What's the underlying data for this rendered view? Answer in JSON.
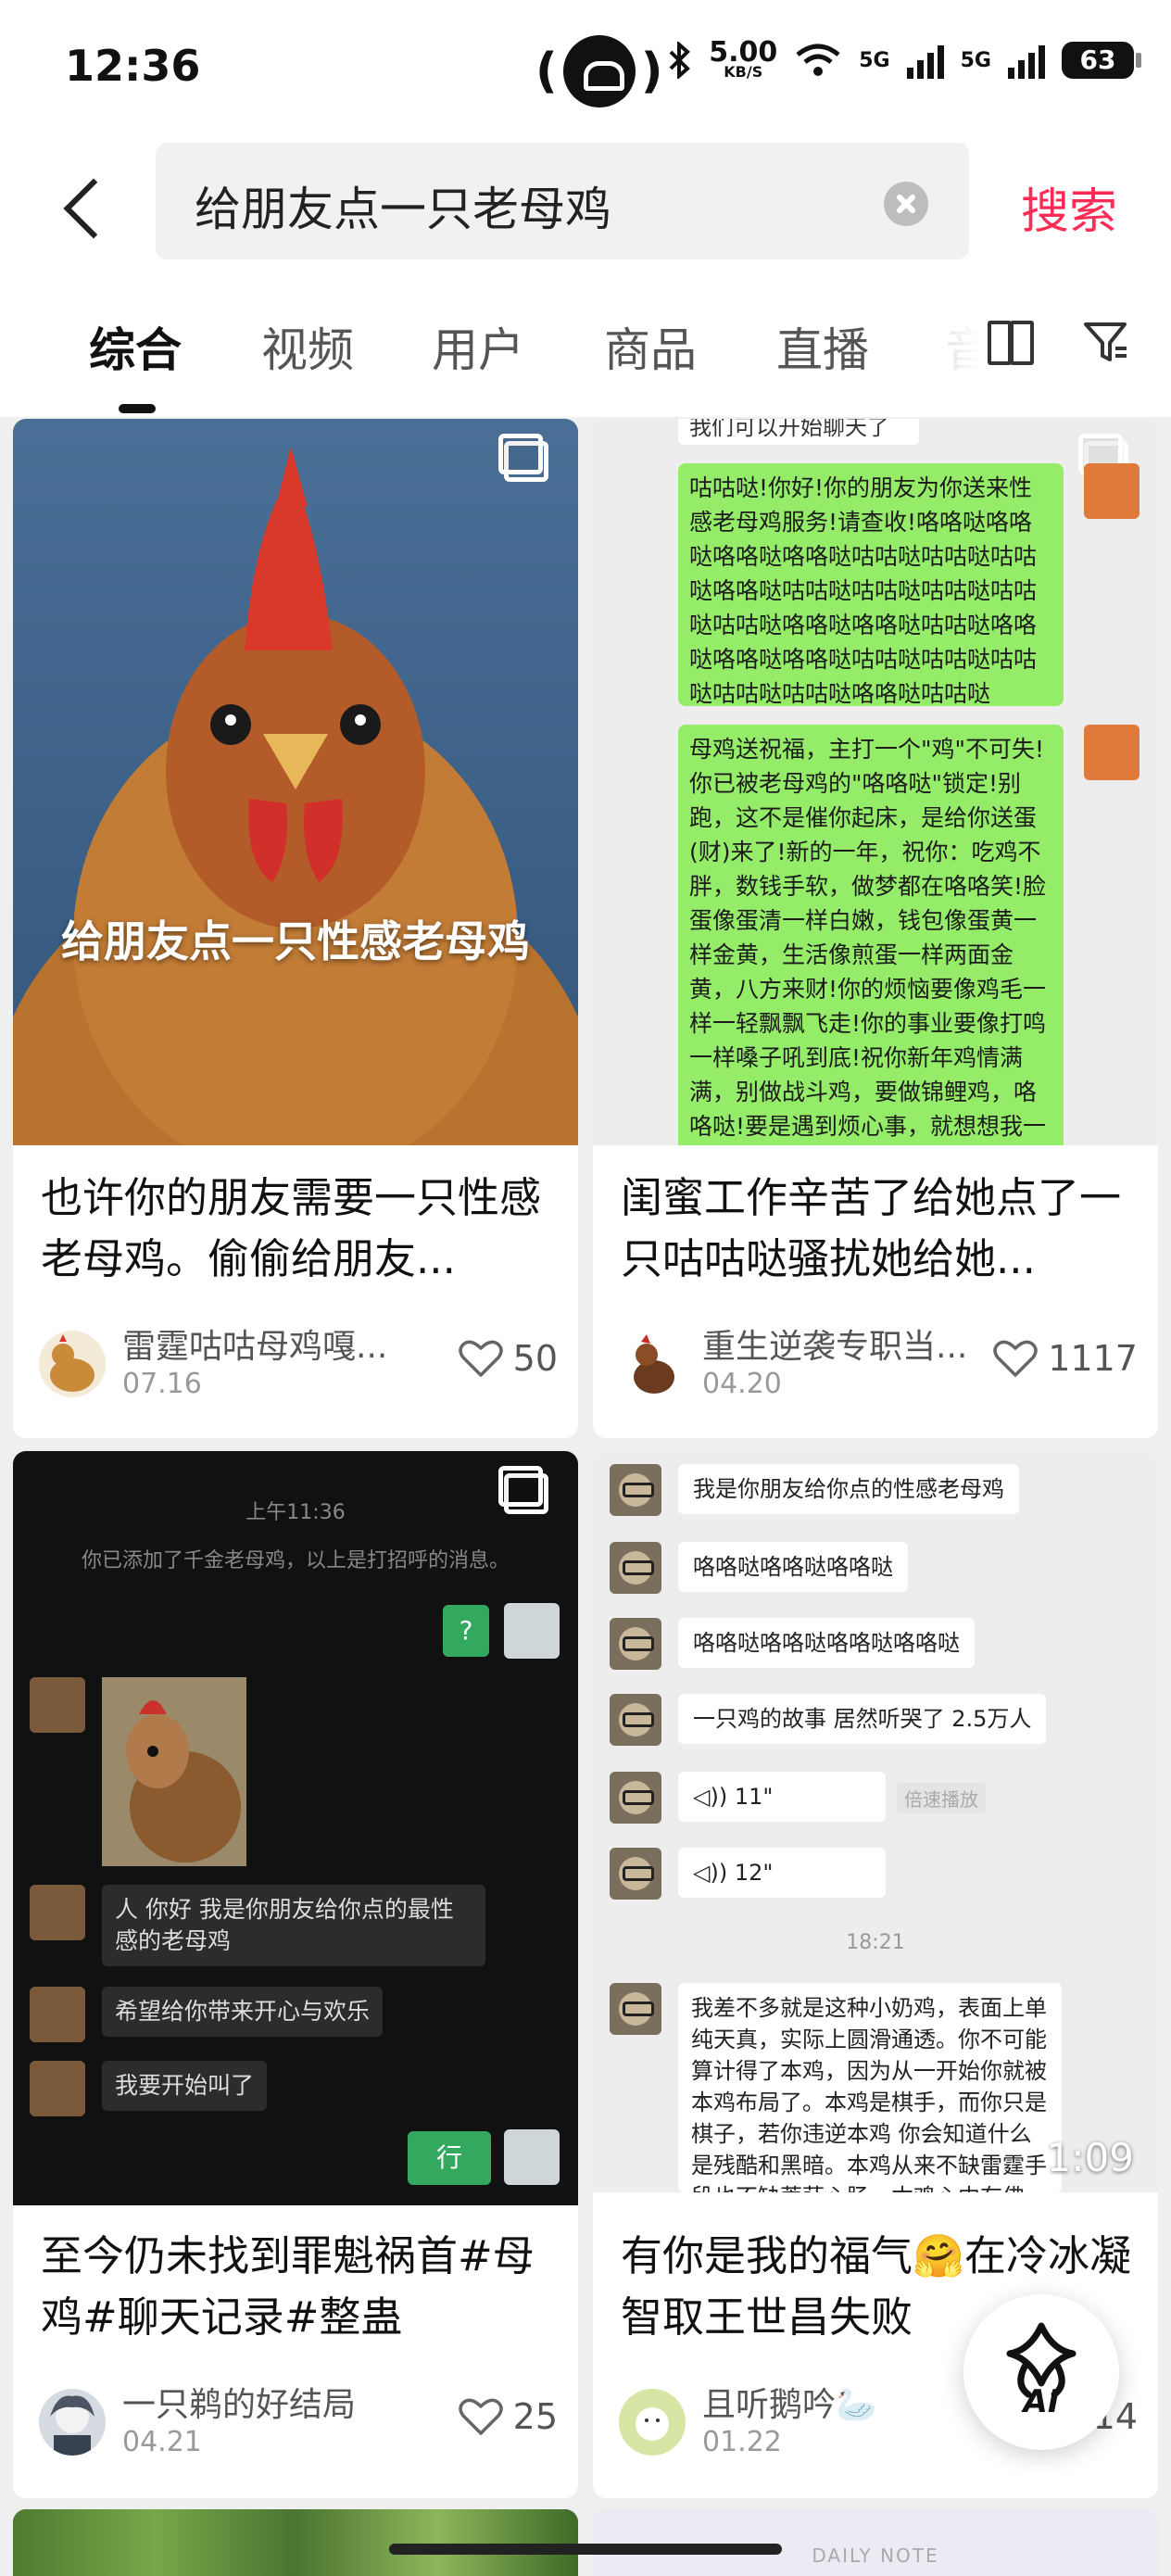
{
  "status": {
    "time": "12:36",
    "speed": "5.00",
    "speed_unit": "KB/S",
    "net1": "5G",
    "net2": "5G",
    "battery": "63"
  },
  "search": {
    "query": "给朋友点一只老母鸡",
    "button": "搜索"
  },
  "tabs": [
    "综合",
    "视频",
    "用户",
    "商品",
    "直播",
    "音"
  ],
  "cards": [
    {
      "title": "也许你的朋友需要一只性感老母鸡。偷偷给朋友...",
      "overlay": "给朋友点一只性感老母鸡",
      "author": "雷霆咕咕母鸡嘎...",
      "date": "07.16",
      "likes": "50"
    },
    {
      "title": "闺蜜工作辛苦了给她点了一只咕咕哒骚扰她给她...",
      "author": "重生逆袭专职当...",
      "date": "04.20",
      "likes": "1117",
      "chat_top": "我们可以开始聊天了",
      "chat1": "咕咕哒!你好!你的朋友为你送来性感老母鸡服务!请查收!咯咯哒咯咯哒咯咯哒咯咯哒咕咕哒咕咕哒咕咕哒咯咯哒咕咕哒咕咕哒咕咕哒咕咕哒咕咕哒咯咯哒咯咯哒咕咕哒咯咯哒咯咯哒咯咯哒咕咕哒咕咕哒咕咕哒咕咕哒咕咕哒咯咯哒咕咕哒",
      "chat2": "母鸡送祝福，主打一个\"鸡\"不可失!你已被老母鸡的\"咯咯哒\"锁定!别跑，这不是催你起床，是给你送蛋(财)来了!新的一年，祝你：吃鸡不胖，数钱手软，做梦都在咯咯笑!脸蛋像蛋清一样白嫩，钱包像蛋黄一样金黄，生活像煎蛋一样两面金黄，八方来财!你的烦恼要像鸡毛一样一轻飘飘飞走!你的事业要像打鸣一样嗓子吼到底!祝你新年鸡情满满，别做战斗鸡，要做锦鲤鸡，咯咯哒!要是遇到烦心事，就想想我一一只鸡都在努力下蛋，你"
    },
    {
      "title": "至今仍未找到罪魁祸首#母鸡#聊天记录#整蛊",
      "author": "一只鹈的好结局",
      "date": "04.21",
      "likes": "25",
      "chat_time": "上午11:36",
      "chat_sys": "你已添加了千金老母鸡，以上是打招呼的消息。",
      "chat_q": "?",
      "msg1": "人 你好 我是你朋友给你点的最性感的老母鸡",
      "msg2": "希望给你带来开心与欢乐",
      "msg3": "我要开始叫了",
      "reply": "行"
    },
    {
      "title": "有你是我的福气🤗在冷冰凝智取王世昌失败",
      "author": "且听鹅吟🦢",
      "date": "01.22",
      "likes": "14",
      "m1": "我是你朋友给你点的性感老母鸡",
      "m2": "咯咯哒咯咯哒咯咯哒",
      "m3": "咯咯哒咯咯哒咯咯哒咯咯哒",
      "m4": "一只鸡的故事 居然听哭了 2.5万人",
      "v1": "11\"",
      "v2": "12\"",
      "speed_tag": "倍速播放",
      "time": "18:21",
      "m5": "我差不多就是这种小奶鸡，表面上单纯天真，实际上圆滑通透。你不可能算计得了本鸡，因为从一开始你就被本鸡布局了。本鸡是棋手，而你只是棋子，若你违逆本鸡 你会知道什么是残酷和黑暗。本鸡从来不缺雷霆手段也不缺菩萨心肠，本鸡心中有佛",
      "duration": "1:09"
    }
  ],
  "bottom_note": "DAILY NOTE",
  "ai_button": "AI"
}
